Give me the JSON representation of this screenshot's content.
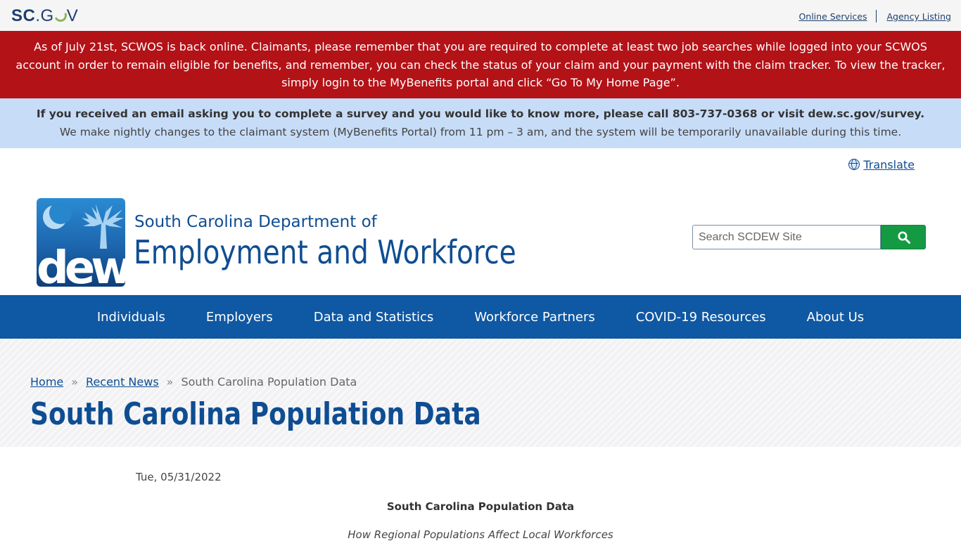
{
  "topbar": {
    "logo_sc": "SC",
    "logo_dot": ".",
    "logo_g": "G",
    "logo_v": "V",
    "links": [
      "Online Services",
      "Agency Listing"
    ]
  },
  "alerts": {
    "red": "As of July 21st, SCWOS is back online. Claimants, please remember that you are required to complete at least two job searches while logged into your SCWOS account in order to remain eligible for benefits, and remember, you can check the status of your claim and your payment with the claim tracker. To view the tracker, simply login to the MyBenefits portal and click “Go To My Home Page”.",
    "blue_bold": "If you received an email asking you to complete a survey and you would like to know more, please call 803-737-0368 or visit dew.sc.gov/survey.",
    "blue_normal": "We make nightly changes to the claimant system (MyBenefits Portal) from 11 pm – 3 am, and the system will be temporarily unavailable during this time."
  },
  "translate_label": "Translate",
  "brand": {
    "logo_text": "dew",
    "dept_small": "South Carolina Department of",
    "dept_big": "Employment and Workforce"
  },
  "search": {
    "placeholder": "Search SCDEW Site",
    "icon": "search-icon",
    "button_color": "#149a43"
  },
  "nav": {
    "items": [
      "Individuals",
      "Employers",
      "Data and Statistics",
      "Workforce Partners",
      "COVID-19 Resources",
      "About Us"
    ],
    "color": "#0f58a3"
  },
  "breadcrumb": {
    "home": "Home",
    "sep": "»",
    "recent": "Recent News",
    "current": "South Carolina Population Data"
  },
  "page_title": "South Carolina Population Data",
  "article": {
    "date": "Tue, 05/31/2022",
    "title": "South Carolina Population Data",
    "subtitle": "How Regional Populations Affect Local Workforces"
  }
}
